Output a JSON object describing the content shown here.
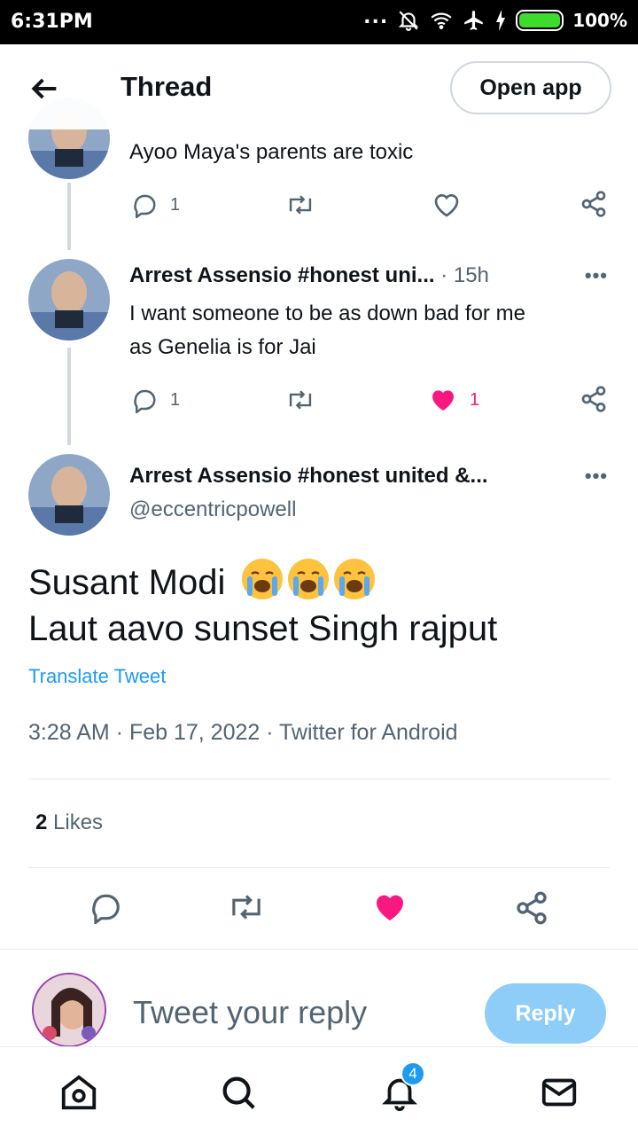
{
  "status_bar": {
    "time": "6:31PM",
    "dots": "...",
    "battery_percent": "100%"
  },
  "header": {
    "title": "Thread",
    "open_app_label": "Open app"
  },
  "tweets": [
    {
      "text": "Ayoo Maya's parents are toxic",
      "actions": {
        "reply_count": "1",
        "retweet_count": "",
        "like_count": ""
      }
    },
    {
      "name": "Arrest Assensio #honest uni...",
      "time": "· 15h",
      "text_line1": "I want someone to be as down bad for me",
      "text_line2": "as Genelia is for Jai",
      "actions": {
        "reply_count": "1",
        "retweet_count": "",
        "like_count": "1"
      }
    }
  ],
  "main_tweet": {
    "name": "Arrest Assensio #honest united &...",
    "handle": "@eccentricpowell",
    "line1": "Susant Modi",
    "line2": "Laut aavo sunset Singh rajput",
    "emoji_name": "loudly-crying-face",
    "translate_label": "Translate Tweet",
    "timestamp": "3:28 AM · Feb 17, 2022 · Twitter for Android",
    "likes_count": "2",
    "likes_label": "Likes"
  },
  "reply": {
    "placeholder": "Tweet your reply",
    "button_label": "Reply"
  },
  "nav": {
    "notifications_badge": "4"
  },
  "colors": {
    "accent": "#1d9bf0",
    "like": "#f91880",
    "muted": "#536471",
    "reply_button": "#8ecdf8"
  }
}
